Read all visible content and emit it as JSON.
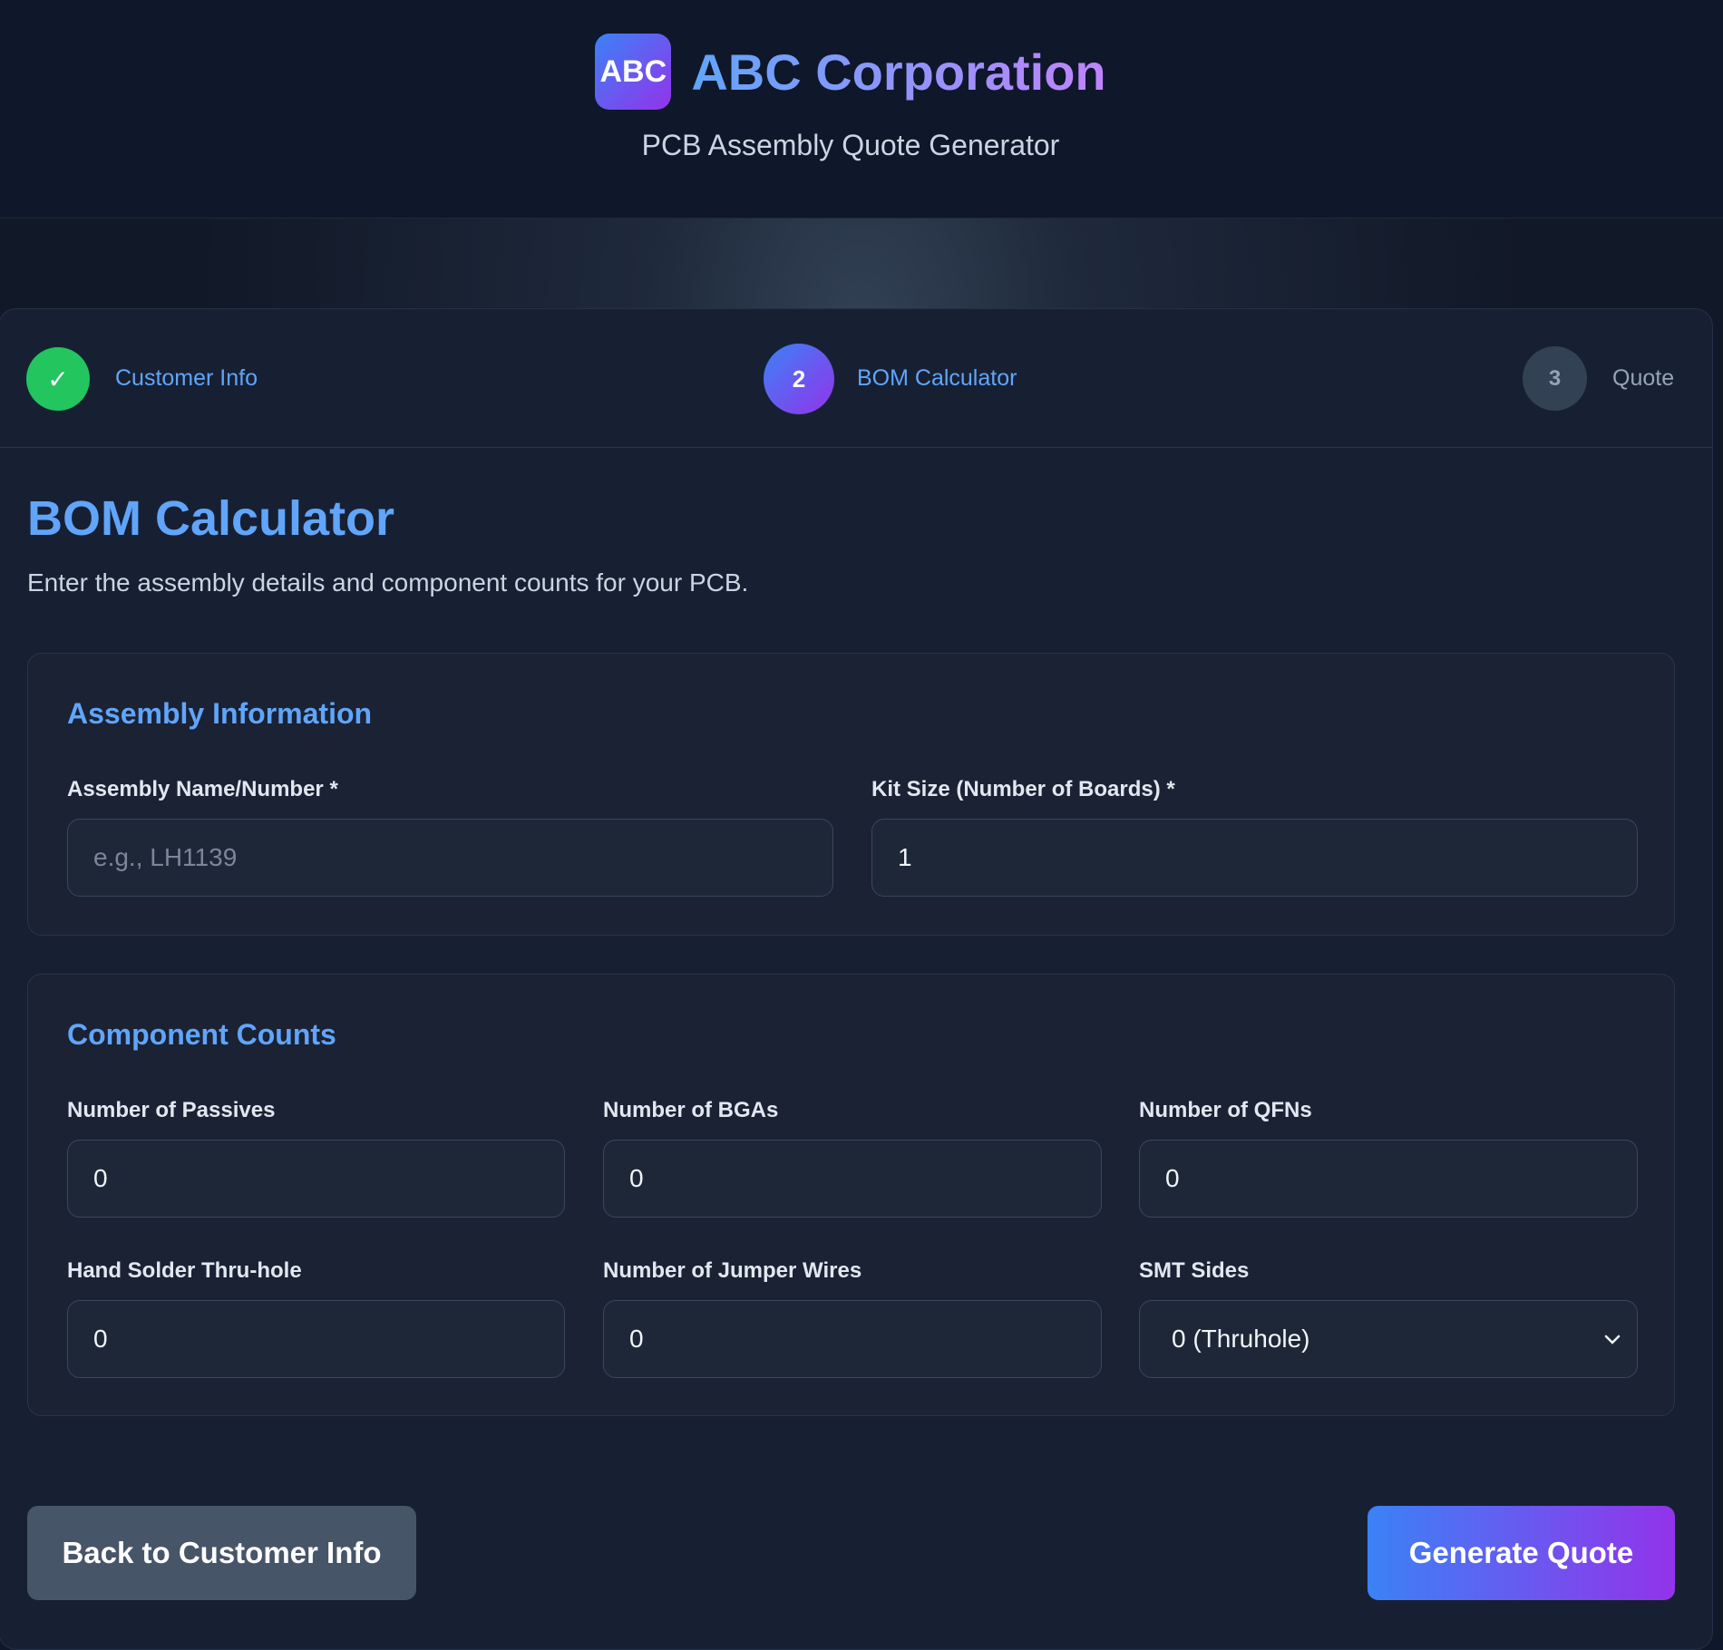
{
  "header": {
    "logo_text": "ABC",
    "company_name": "ABC Corporation",
    "subtitle": "PCB Assembly Quote Generator"
  },
  "steps": [
    {
      "marker": "✓",
      "label": "Customer Info",
      "state": "complete"
    },
    {
      "marker": "2",
      "label": "BOM Calculator",
      "state": "active"
    },
    {
      "marker": "3",
      "label": "Quote",
      "state": "pending"
    }
  ],
  "page": {
    "title": "BOM Calculator",
    "description": "Enter the assembly details and component counts for your PCB."
  },
  "assembly": {
    "section_title": "Assembly Information",
    "name_label": "Assembly Name/Number *",
    "name_value": "",
    "name_placeholder": "e.g., LH1139",
    "kit_label": "Kit Size (Number of Boards) *",
    "kit_value": "1"
  },
  "components": {
    "section_title": "Component Counts",
    "passives_label": "Number of Passives",
    "passives_value": "0",
    "bgas_label": "Number of BGAs",
    "bgas_value": "0",
    "qfns_label": "Number of QFNs",
    "qfns_value": "0",
    "thruhole_label": "Hand Solder Thru-hole",
    "thruhole_value": "0",
    "jumpers_label": "Number of Jumper Wires",
    "jumpers_value": "0",
    "smt_label": "SMT Sides",
    "smt_value": "0 (Thruhole)"
  },
  "actions": {
    "back_label": "Back to Customer Info",
    "generate_label": "Generate Quote"
  },
  "colors": {
    "accent_blue": "#3b82f6",
    "accent_purple": "#9333ea",
    "success": "#22c55e",
    "background": "#0f172a"
  },
  "icons": {
    "check": "check-icon",
    "select_arrow": "chevron-down-icon"
  }
}
